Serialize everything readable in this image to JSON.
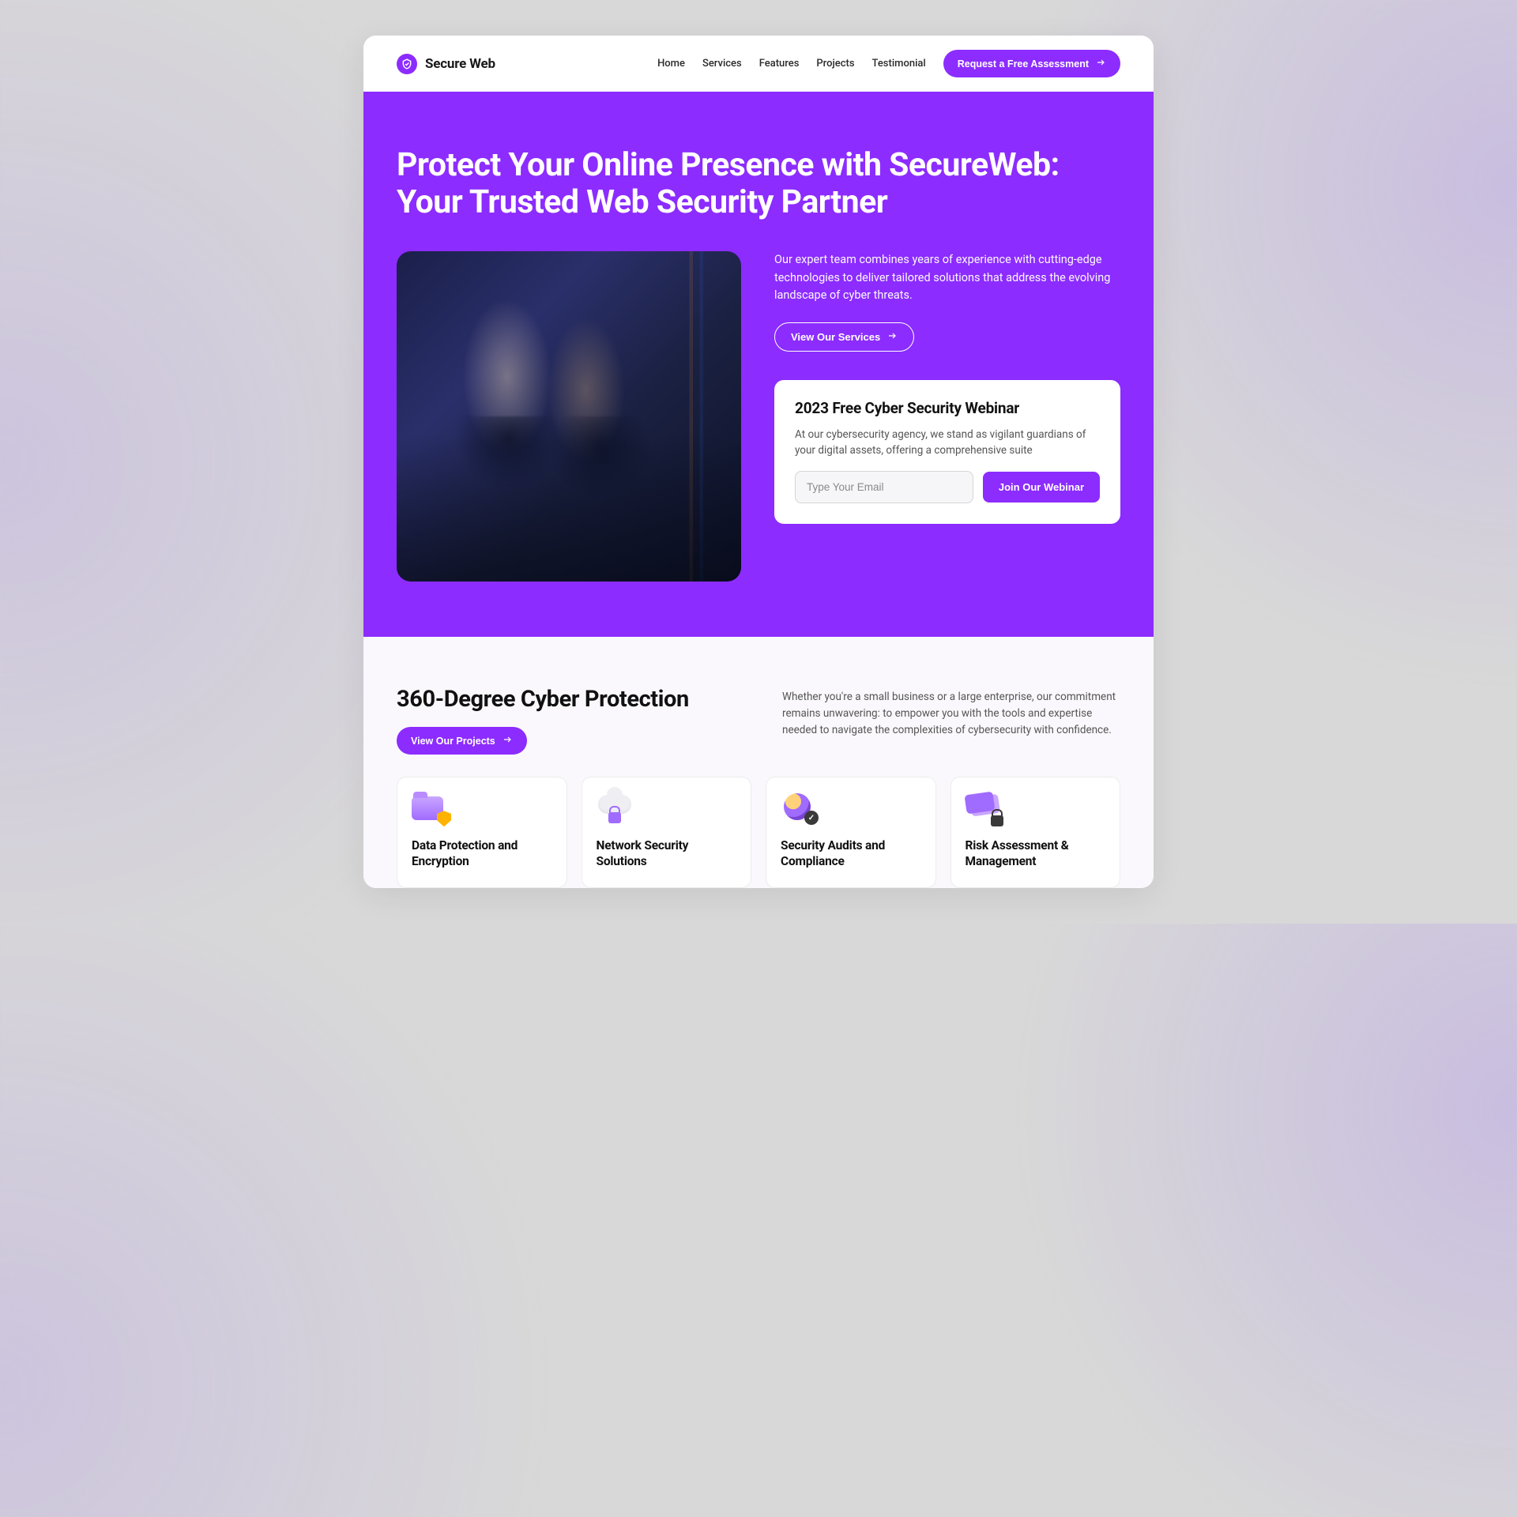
{
  "brand": {
    "name": "Secure Web"
  },
  "nav": {
    "links": [
      "Home",
      "Services",
      "Features",
      "Projects",
      "Testimonial"
    ],
    "cta": "Request a Free Assessment"
  },
  "hero": {
    "title": "Protect Your Online Presence with SecureWeb: Your Trusted Web Security Partner",
    "desc": "Our expert team combines years of experience with cutting-edge technologies to deliver tailored solutions that address the evolving landscape of cyber threats.",
    "services_btn": "View Our Services",
    "webinar": {
      "title": "2023 Free Cyber Security Webinar",
      "desc": "At our cybersecurity agency, we stand as vigilant guardians of your digital assets, offering a comprehensive suite",
      "placeholder": "Type Your Email",
      "button": "Join Our Webinar"
    }
  },
  "section360": {
    "title": "360-Degree Cyber Protection",
    "desc": "Whether you're a small business or a large enterprise, our commitment remains unwavering: to empower you with the tools and expertise needed to navigate the complexities of cybersecurity with confidence.",
    "projects_btn": "View Our Projects",
    "cards": [
      {
        "title": "Data Protection and Encryption"
      },
      {
        "title": "Network Security Solutions"
      },
      {
        "title": "Security Audits and Compliance"
      },
      {
        "title": "Risk Assessment & Management"
      }
    ]
  }
}
